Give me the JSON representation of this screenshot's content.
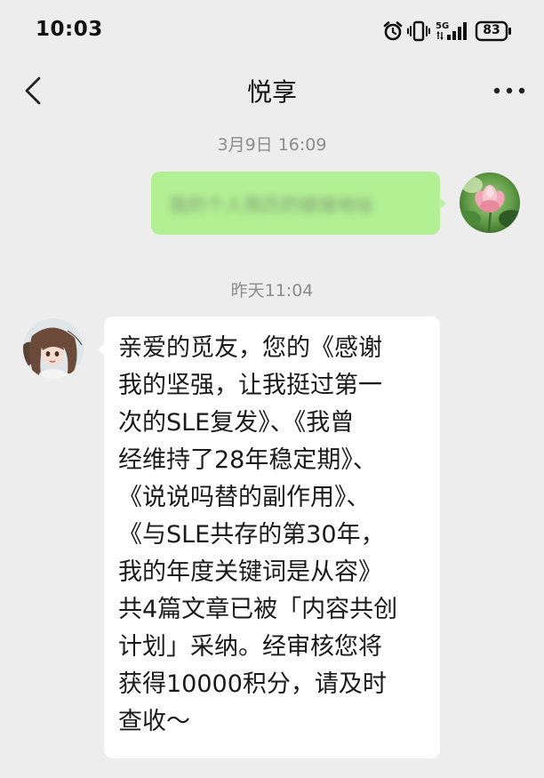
{
  "status": {
    "time": "10:03",
    "network": "5G",
    "battery": "83"
  },
  "nav": {
    "title": "悦享"
  },
  "messages": {
    "timestamp_1": "3月9日 16:09",
    "self_text": "我的个人简历的链接地址",
    "timestamp_2": "昨天11:04",
    "lines": [
      "亲爱的觅友，您的《感谢",
      "我的坚强，让我挺过第一",
      "次的SLE复发》、《我曾",
      "经维持了28年稳定期》、",
      "《说说吗替的副作用》、",
      "《与SLE共存的第30年，",
      "我的年度关键词是从容》",
      "共4篇文章已被「内容共创",
      "计划」采纳。经审核您将",
      "获得10000积分，请及时",
      "查收～"
    ]
  },
  "colors": {
    "background": "#ededed",
    "self_bubble": "#95ec69",
    "other_bubble": "#ffffff",
    "timestamp": "#8c8c8c"
  },
  "icons": [
    "back-arrow-icon",
    "more-icon",
    "alarm-icon",
    "vibrate-icon",
    "signal-icon",
    "battery-icon"
  ]
}
